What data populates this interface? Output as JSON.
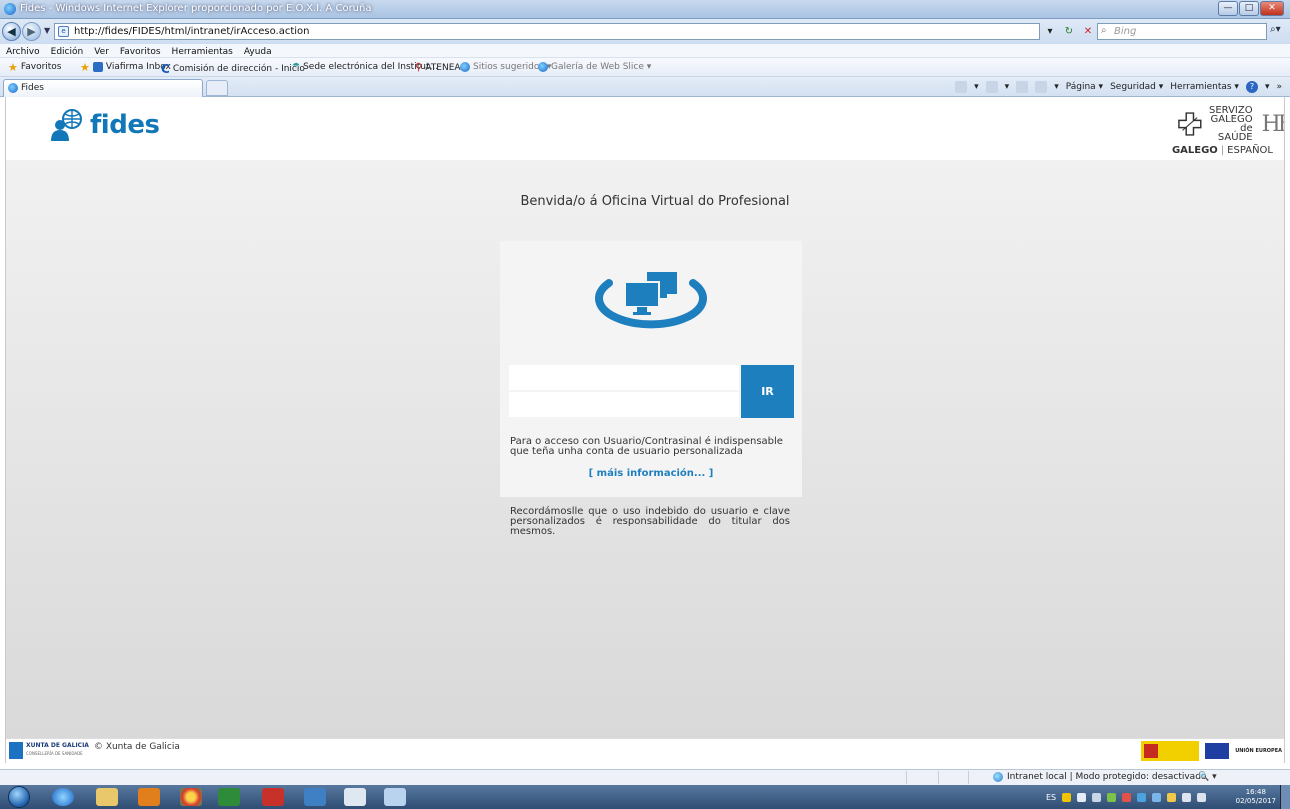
{
  "window": {
    "title": "Fides - Windows Internet Explorer proporcionado por E.O.X.I. A Coruña",
    "min": "—",
    "max": "□",
    "close": "✕"
  },
  "addressbar": {
    "url": "http://fides/FIDES/html/intranet/irAcceso.action",
    "search_placeholder": "Bing"
  },
  "menu": [
    "Archivo",
    "Edición",
    "Ver",
    "Favoritos",
    "Herramientas",
    "Ayuda"
  ],
  "favorites": {
    "label": "Favoritos",
    "items": [
      {
        "label": "Viafirma Inbox"
      },
      {
        "label": "Comisión de dirección - Inicio"
      },
      {
        "label": "Sede electrónica del Institut..."
      },
      {
        "label": "ATENEA"
      },
      {
        "label": "Sitios sugeridos ▾"
      },
      {
        "label": "Galería de Web Slice ▾"
      }
    ]
  },
  "tab": {
    "label": "Fides"
  },
  "commandbar": {
    "page": "Página ▾",
    "security": "Seguridad ▾",
    "tools": "Herramientas ▾"
  },
  "site": {
    "logo": "fides",
    "sergas": [
      "SERVIZO",
      "GALEGO",
      "de SAÚDE"
    ],
    "lang_active": "GALEGO",
    "lang_other": "ESPAÑOL",
    "welcome": "Benvida/o á Oficina Virtual do Profesional",
    "login": {
      "user_value": "",
      "pass_value": "",
      "button": "IR",
      "note": "Para o acceso con Usuario/Contrasinal é indispensable que teña unha conta de usuario personalizada",
      "more_info": "[ máis información... ]"
    },
    "reminder": "Recordámoslle que o uso indebido do usuario e clave personalizados é responsabilidade do titular dos mesmos.",
    "footer": {
      "xunta": "XUNTA DE GALICIA",
      "xunta_sub": "CONSELLERÍA DE SANIDADE",
      "copyright": "© Xunta de Galicia",
      "eu": "UNIÓN EUROPEA"
    }
  },
  "statusbar": {
    "zone": "Intranet local | Modo protegido: desactivado",
    "zoom": "🔍 ▾"
  },
  "taskbar": {
    "lang": "ES",
    "time": "16:48",
    "date": "02/05/2017"
  },
  "colors": {
    "accent": "#1e7fbf",
    "brand": "#1177b9"
  }
}
